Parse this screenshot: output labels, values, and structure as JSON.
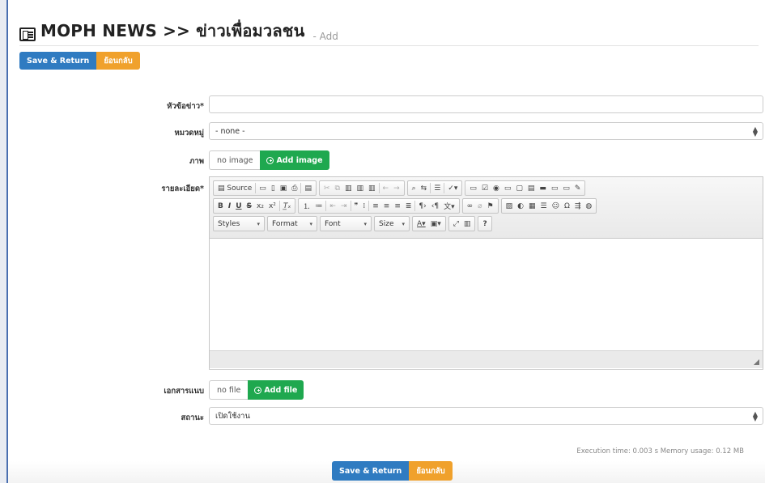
{
  "header": {
    "title": "MOPH NEWS >> ข่าวเพื่อมวลชน",
    "subtitle": "- Add"
  },
  "actions": {
    "save_return": "Save & Return",
    "back": "ย้อนกลับ"
  },
  "form": {
    "headline_label": "หัวข้อข่าว*",
    "headline_value": "",
    "category_label": "หมวดหมู่",
    "category_value": "- none -",
    "image_label": "ภาพ",
    "image_value": "no image",
    "image_button": "Add image",
    "detail_label": "รายละเอียด*",
    "attachment_label": "เอกสารแนบ",
    "attachment_value": "no file",
    "attachment_button": "Add file",
    "status_label": "สถานะ",
    "status_value": "เปิดใช้งาน"
  },
  "editor": {
    "source_label": "Source",
    "styles_label": "Styles",
    "format_label": "Format",
    "font_label": "Font",
    "size_label": "Size"
  },
  "footer": {
    "execution": "Execution time: 0.003 s  Memory usage: 0.12 MB"
  }
}
